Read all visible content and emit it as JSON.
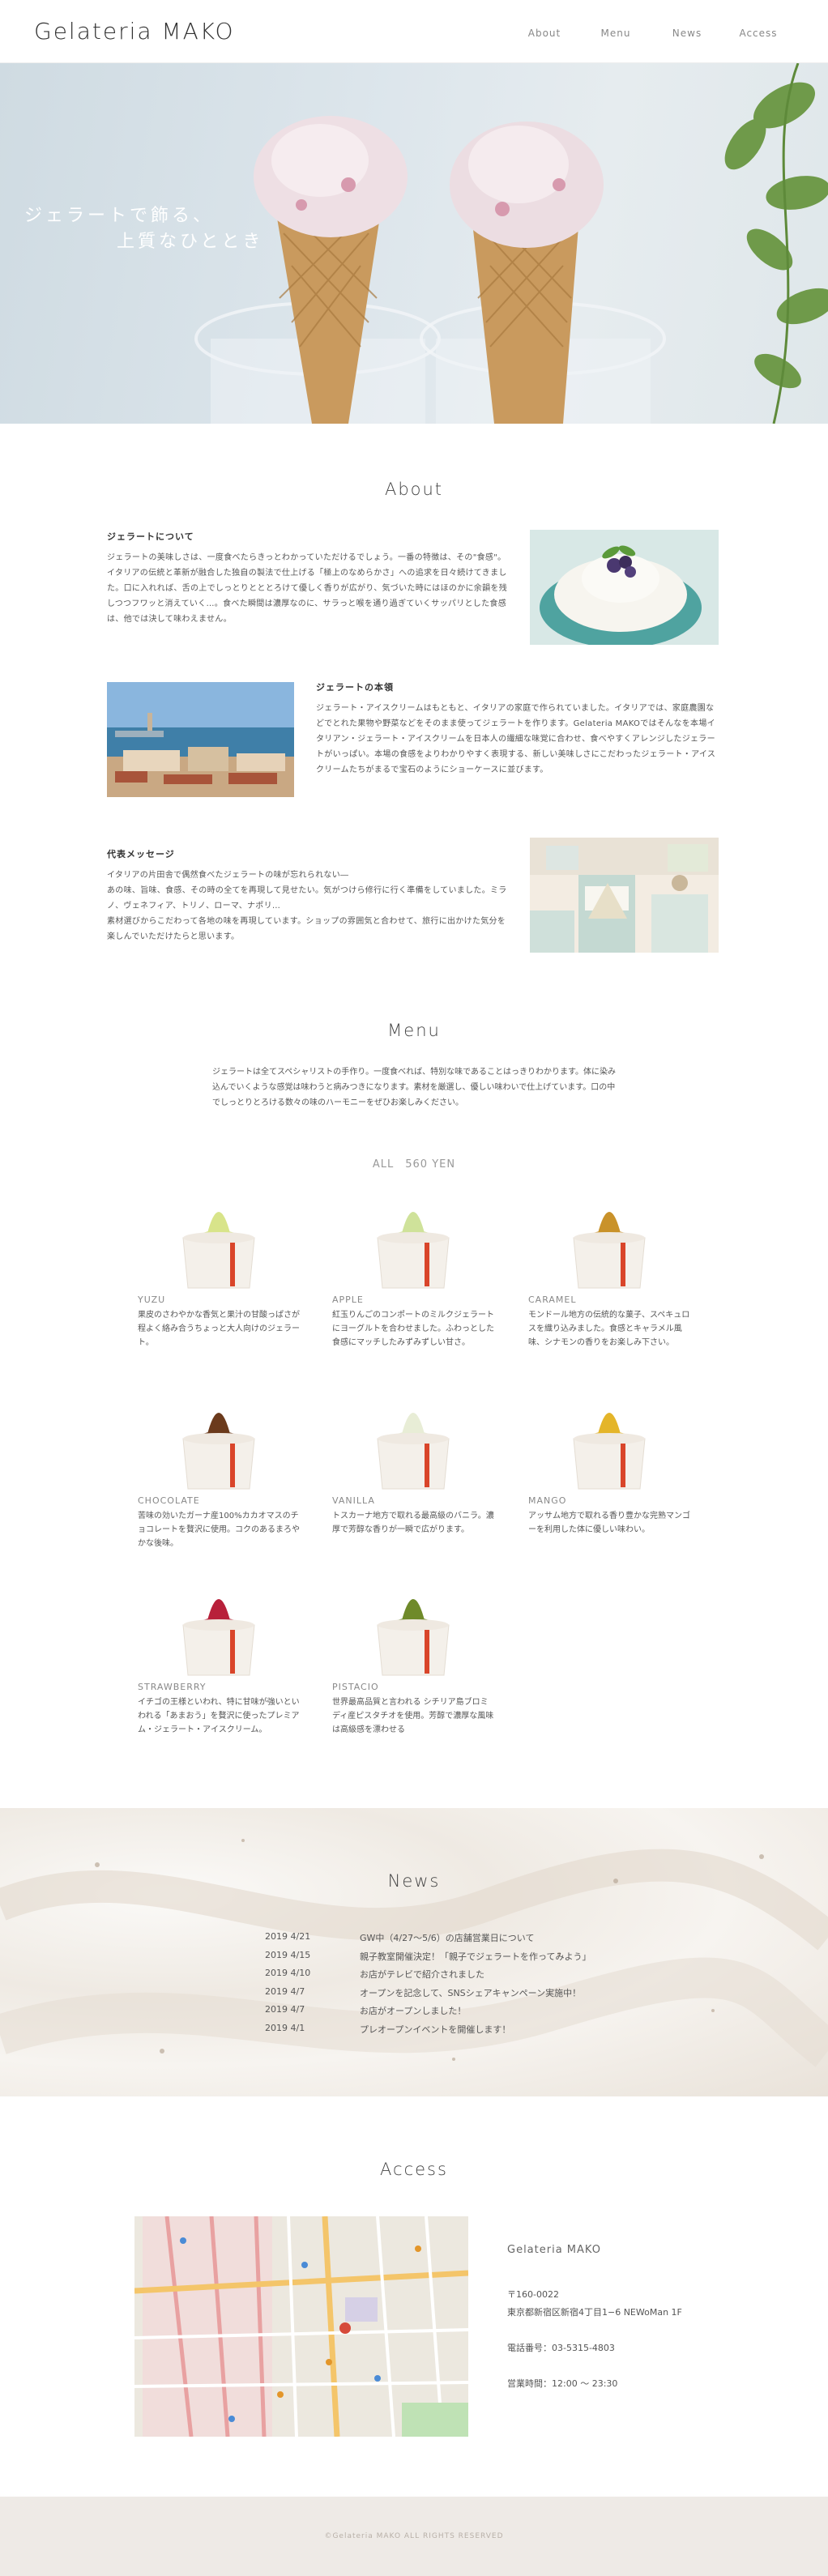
{
  "site": {
    "logo": "Gelateria MAKO"
  },
  "nav": {
    "items": [
      "About",
      "Menu",
      "News",
      "Access"
    ]
  },
  "hero": {
    "line1": "ジェラートで飾る、",
    "line2": "上質なひととき"
  },
  "about": {
    "title": "About",
    "blocks": [
      {
        "heading": "ジェラートについて",
        "text": "ジェラートの美味しさは、一度食べたらきっとわかっていただけるでしょう。一番の特徴は、その\"食感\"。イタリアの伝統と革新が融合した独自の製法で仕上げる「極上のなめらかさ」への追求を日々続けてきました。口に入れれば、舌の上でしっとりとととろけて優しく香りが広がり、気づいた時にはほのかに余韻を残しつつフワッと消えていく…。食べた瞬間は濃厚なのに、サラっと喉を通り過ぎていくサッパリとした食感は、他では決して味わえません。"
      },
      {
        "heading": "ジェラートの本領",
        "text": "ジェラート・アイスクリームはもともと、イタリアの家庭で作られていました。イタリアでは、家庭農園などでとれた果物や野菜などをそのまま使ってジェラートを作ります。Gelateria MAKOではそんなを本場イタリアン・ジェラート・アイスクリームを日本人の繊細な味覚に合わせ、食べやすくアレンジしたジェラートがいっぱい。本場の食感をよりわかりやすく表現する、新しい美味しさにこだわったジェラート・アイスクリームたちがまるで宝石のようにショーケースに並びます。"
      },
      {
        "heading": "代表メッセージ",
        "text": "イタリアの片田舎で偶然食べたジェラートの味が忘れられない―\nあの味、旨味、食感、その時の全てを再現して見せたい。気がつけら修行に行く準備をしていました。ミラノ、ヴェネフィア、トリノ、ローマ、ナポリ…\n素材選びからこだわって各地の味を再現しています。ショップの雰囲気と合わせて、旅行に出かけた気分を楽しんでいただけたらと思います。"
      }
    ]
  },
  "menu": {
    "title": "Menu",
    "intro": "ジェラートは全てスペシャリストの手作り。一度食べれば、特別な味であることはっきりわかります。体に染み込んでいくような感覚は味わうと病みつきになります。素材を厳選し、優しい味わいで仕上げています。口の中でしっとりとろける数々の味のハーモニーをぜひお楽しみください。",
    "price": "ALL　560 YEN",
    "items": [
      {
        "name": "YUZU",
        "desc": "果皮のさわやかな香気と果汁の甘酸っぱさが程よく絡み合うちょっと大人向けのジェラート。",
        "color": "#d8e48a"
      },
      {
        "name": "APPLE",
        "desc": "紅玉りんごのコンポートのミルクジェラートにヨーグルトを合わせました。ふわっとした食感にマッチしたみずみずしい甘さ。",
        "color": "#cfe29a"
      },
      {
        "name": "CARAMEL",
        "desc": "モンドール地方の伝統的な菓子、スペキュロスを織り込みました。食感とキャラメル風味、シナモンの香りをお楽しみ下さい。",
        "color": "#c9922a"
      },
      {
        "name": "CHOCOLATE",
        "desc": "苦味の効いたガーナ産100%カカオマスのチョコレートを贅沢に使用。コクのあるまろやかな後味。",
        "color": "#6b3a1c"
      },
      {
        "name": "VANILLA",
        "desc": "トスカーナ地方で取れる最高級のバニラ。濃厚で芳醇な香りが一瞬で広がります。",
        "color": "#e8edd6"
      },
      {
        "name": "MANGO",
        "desc": "アッサム地方で取れる香り豊かな完熟マンゴーを利用した体に優しい味わい。",
        "color": "#e4b52a"
      },
      {
        "name": "STRAWBERRY",
        "desc": "イチゴの王様といわれ、特に甘味が強いといわれる「あまおう」を贅沢に使ったプレミアム・ジェラート・アイスクリーム。",
        "color": "#b8203a"
      },
      {
        "name": "PISTACIO",
        "desc": "世界最高品質と言われる シチリア島ブロミディ産ピスタチオを使用。芳醇で濃厚な風味は高級感を漂わせる",
        "color": "#6f8a2a"
      }
    ]
  },
  "news": {
    "title": "News",
    "rows": [
      {
        "date": "2019 4/21",
        "text": "GW中（4/27〜5/6）の店舗営業日について"
      },
      {
        "date": "2019 4/15",
        "text": "親子教室開催決定！「親子でジェラートを作ってみよう」"
      },
      {
        "date": "2019 4/10",
        "text": "お店がテレビで紹介されました"
      },
      {
        "date": "2019 4/7",
        "text": "オープンを記念して、SNSシェアキャンペーン実施中！"
      },
      {
        "date": "2019 4/7",
        "text": "お店がオープンしました！"
      },
      {
        "date": "2019 4/1",
        "text": "プレオープンイベントを開催します！"
      }
    ]
  },
  "access": {
    "title": "Access",
    "shop": "Gelateria MAKO",
    "zip": "〒160-0022",
    "address": "東京都新宿区新宿4丁目1−6 NEWoMan 1F",
    "tel": "電話番号：03-5315-4803",
    "hours": "営業時間：12:00 〜 23:30"
  },
  "footer": {
    "copyright": "©Gelateria MAKO ALL RIGHTS RESERVED"
  }
}
